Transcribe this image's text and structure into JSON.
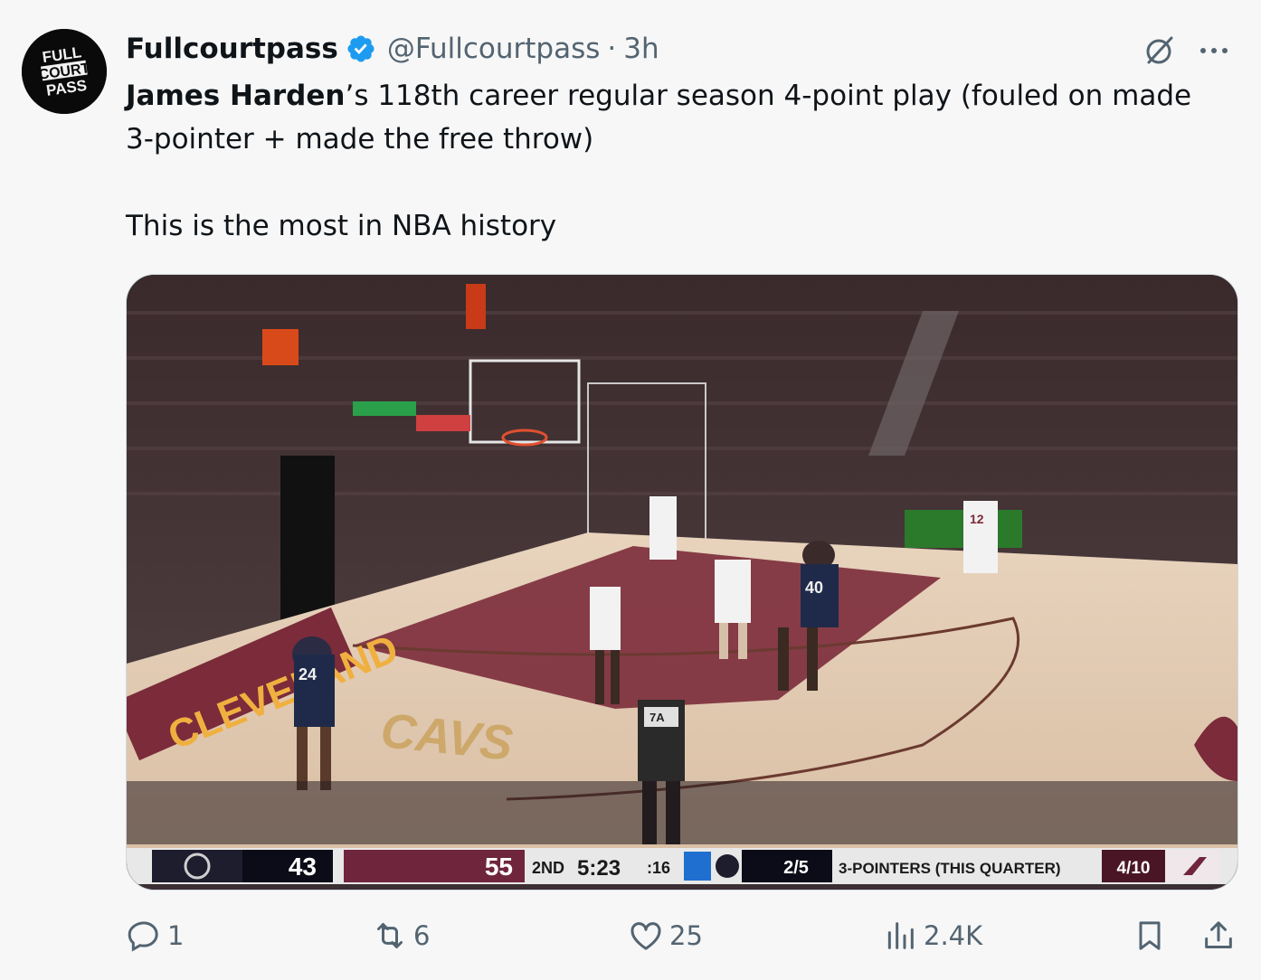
{
  "author": {
    "display_name": "Fullcourtpass",
    "handle": "@Fullcourtpass",
    "separator": "·",
    "time_ago": "3h",
    "avatar_text": [
      "FULL",
      "COURT",
      "PASS"
    ]
  },
  "tweet": {
    "bold_name": "James Harden",
    "text_part1": "’s 118th career regular season 4-point play (fouled on made",
    "text_part2": "3-pointer + made the free throw)",
    "text_part3": "This is the most in NBA history"
  },
  "media": {
    "scorebug": {
      "away_score": "43",
      "home_score": "55",
      "period": "2ND",
      "clock": "5:23",
      "shot_clock": ":16",
      "away_stat": "2/5",
      "stat_label": "3-POINTERS (THIS QUARTER)",
      "home_stat": "4/10"
    },
    "court_text": "CAVS",
    "baseline_text": "CLEVELAND",
    "jersey_numbers": [
      "24",
      "40",
      "12",
      "7A"
    ]
  },
  "actions": {
    "replies": "1",
    "reposts": "6",
    "likes": "25",
    "views": "2.4K"
  },
  "colors": {
    "verified_blue": "#1d9bf0",
    "muted": "#536471",
    "cavs_wine": "#6f263d"
  }
}
